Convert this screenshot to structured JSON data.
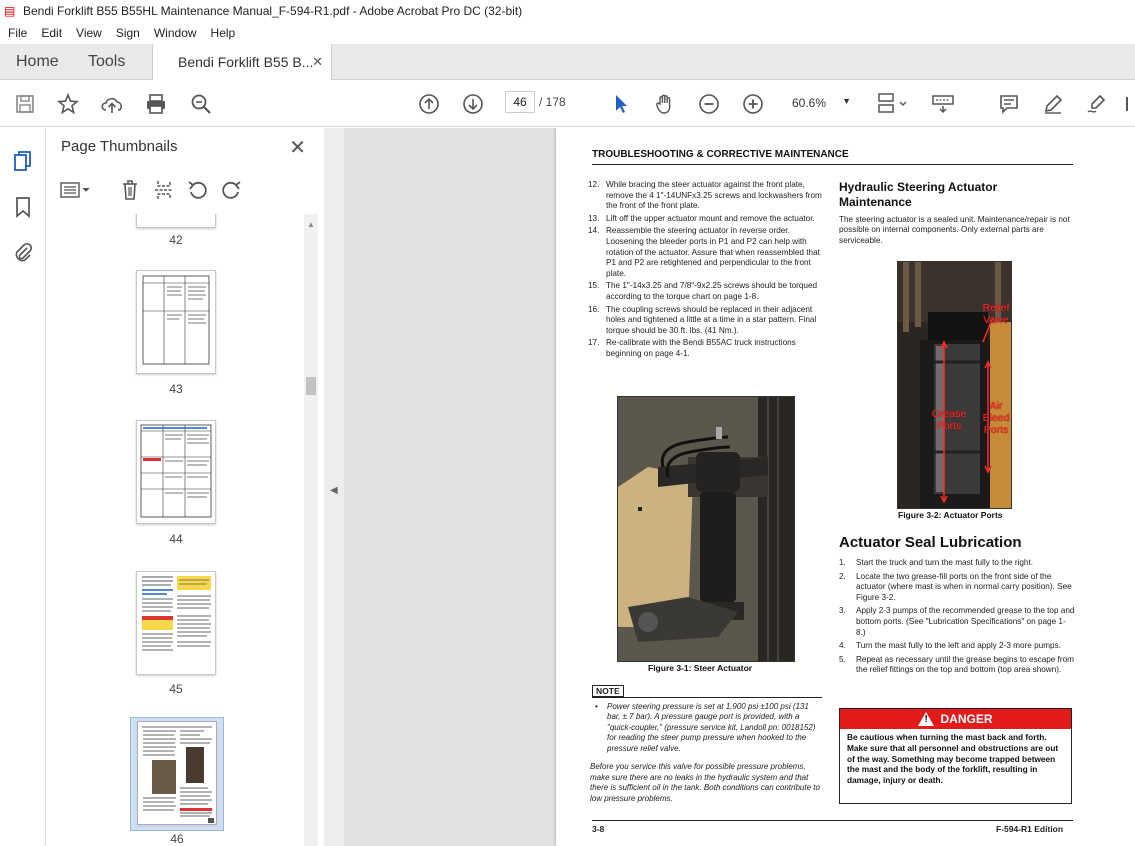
{
  "window": {
    "title": "Bendi Forklift B55 B55HL Maintenance Manual_F-594-R1.pdf - Adobe Acrobat Pro DC (32-bit)"
  },
  "menu": [
    "File",
    "Edit",
    "View",
    "Sign",
    "Window",
    "Help"
  ],
  "tabs": {
    "home": "Home",
    "tools": "Tools",
    "doc": "Bendi Forklift B55 B..."
  },
  "toolbar": {
    "page_current": "46",
    "page_total": "/  178",
    "zoom": "60.6%"
  },
  "panel": {
    "title": "Page Thumbnails"
  },
  "thumbnails": [
    {
      "label": "42"
    },
    {
      "label": "43"
    },
    {
      "label": "44"
    },
    {
      "label": "45"
    },
    {
      "label": "46"
    }
  ],
  "doc": {
    "header": "TROUBLESHOOTING & CORRECTIVE MAINTENANCE",
    "steps": [
      {
        "n": "12.",
        "text": "While bracing the steer actuator against the front plate, remove the 4 1\"-14UNFx3.25 screws and lockwashers from the front of the front plate."
      },
      {
        "n": "13.",
        "text": "Lift off the upper actuator mount and remove the actuator."
      },
      {
        "n": "14.",
        "text": "Reassemble the steering actuator in reverse order. Loosening the bleeder ports in P1 and P2 can help with rotation of the actuator. Assure that when reassembled that P1 and P2 are retightened and perpendicular to the front plate."
      },
      {
        "n": "15.",
        "text": "The 1\"-14x3.25 and 7/8\"-9x2.25 screws should be torqued according to the torque chart on page 1-8."
      },
      {
        "n": "16.",
        "text": "The coupling screws should be replaced in their adjacent holes and tightened a little at a time in a star pattern. Final torque should be 30 ft. lbs. (41 Nm.)."
      },
      {
        "n": "17.",
        "text": "Re-calibrate with the Bendi B55AC truck instructions beginning on page 4-1."
      }
    ],
    "fig1_caption": "Figure 3-1:  Steer Actuator",
    "note_label": "NOTE",
    "note_bullet": "Power steering pressure is set at 1,900 psi ±100 psi (131 bar, ± 7 bar). A pressure gauge port is provided, with a \"quick-coupler,\" (pressure service kit, Landoll pn: 0018152) for reading the steer pump pressure when hooked to the pressure relief valve.",
    "note_para": "Before you service this valve for possible pressure problems, make sure there are no leaks in the hydraulic system and that there is sufficient oil in the tank. Both conditions can contribute to low pressure problems.",
    "h_hydraulic": "Hydraulic Steering Actuator Maintenance",
    "p_hydraulic": "The steering actuator is a sealed unit. Maintenance/repair is not possible on internal components. Only external parts are serviceable.",
    "fig2_labels": {
      "relief": "Relief Valve",
      "grease": "Grease Ports",
      "air": "Air Bleed Ports"
    },
    "fig2_caption": "Figure 3-2:  Actuator Ports",
    "h_seal": "Actuator Seal Lubrication",
    "seal_steps": [
      {
        "n": "1.",
        "text": "Start the truck and turn the mast fully to the right."
      },
      {
        "n": "2.",
        "text": "Locate the two grease-fill ports on the front side of the actuator (where mast is when in normal carry position). See Figure 3-2."
      },
      {
        "n": "3.",
        "text": "Apply 2-3 pumps of the recommended grease to the top and bottom ports. (See \"Lubrication Specifications\" on page 1-8.)"
      },
      {
        "n": "4.",
        "text": "Turn the mast fully to the left and apply 2-3 more pumps."
      },
      {
        "n": "5.",
        "text": "Repeat as necessary until the grease begins to escape from the relief fittings on the top and bottom (top area shown)."
      }
    ],
    "danger_title": "DANGER",
    "danger_text": "Be cautious when turning the mast back and forth. Make sure that all personnel and obstructions are out of the way. Something may become trapped between the mast and the body of the forklift, resulting in damage, injury or death.",
    "footer_left": "3-8",
    "footer_right": "F-594-R1 Edition"
  }
}
